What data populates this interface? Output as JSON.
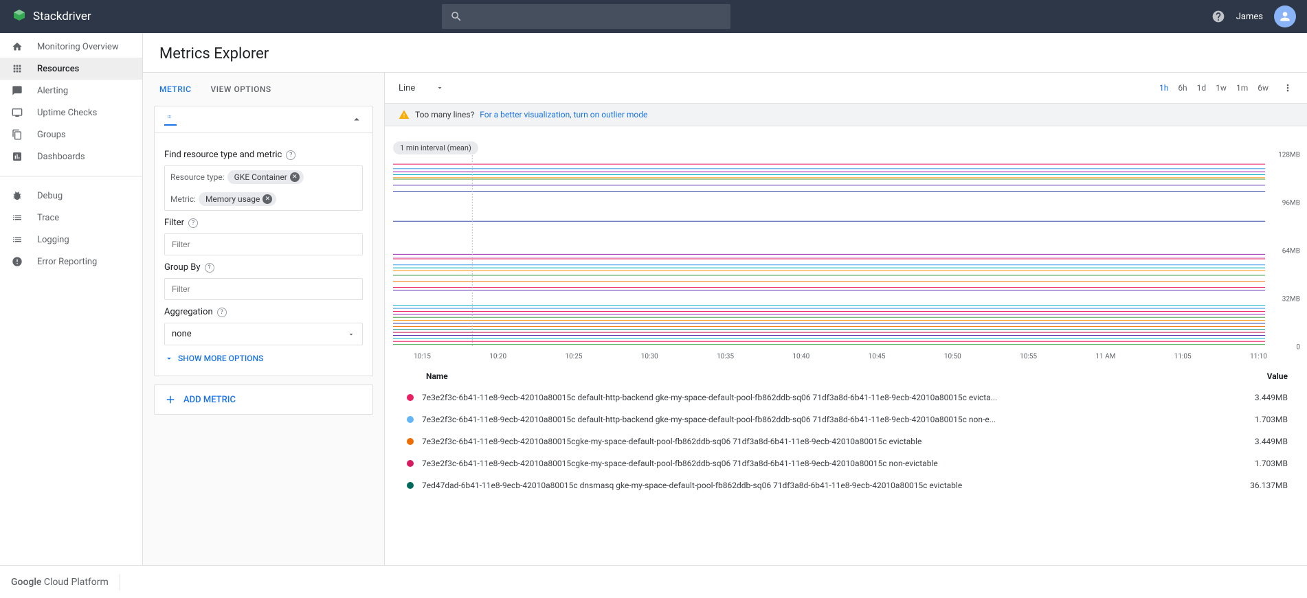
{
  "header": {
    "brand": "Stackdriver",
    "user": "James"
  },
  "sidebar": {
    "items": [
      {
        "label": "Monitoring Overview"
      },
      {
        "label": "Resources"
      },
      {
        "label": "Alerting"
      },
      {
        "label": "Uptime Checks"
      },
      {
        "label": "Groups"
      },
      {
        "label": "Dashboards"
      }
    ],
    "items2": [
      {
        "label": "Debug"
      },
      {
        "label": "Trace"
      },
      {
        "label": "Logging"
      },
      {
        "label": "Error Reporting"
      }
    ]
  },
  "page": {
    "title": "Metrics Explorer"
  },
  "config": {
    "tab_metric": "METRIC",
    "tab_view": "VIEW OPTIONS",
    "find_label": "Find resource type and metric",
    "resource_type_label": "Resource type:",
    "resource_type_value": "GKE Container",
    "metric_label": "Metric:",
    "metric_value": "Memory usage",
    "filter_label": "Filter",
    "filter_placeholder": "Filter",
    "groupby_label": "Group By",
    "groupby_placeholder": "Filter",
    "agg_label": "Aggregation",
    "agg_value": "none",
    "show_more": "SHOW MORE OPTIONS",
    "add_metric": "ADD METRIC"
  },
  "chart": {
    "type_label": "Line",
    "ranges": [
      "1h",
      "6h",
      "1d",
      "1w",
      "1m",
      "6w"
    ],
    "active_range": "1h",
    "warning_prefix": "Too many lines?",
    "warning_link": "For a better visualization, turn on outlier mode",
    "interval_chip": "1 min interval (mean)"
  },
  "chart_data": {
    "type": "line",
    "title": "",
    "xlabel": "",
    "ylabel": "",
    "ylim": [
      0,
      128
    ],
    "y_unit": "MB",
    "y_ticks": [
      "128MB",
      "96MB",
      "64MB",
      "32MB",
      "0"
    ],
    "x_ticks": [
      "10:15",
      "10:20",
      "10:25",
      "10:30",
      "10:35",
      "10:40",
      "10:45",
      "10:50",
      "10:55",
      "11 AM",
      "11:05",
      "11:10"
    ],
    "cursor_x": "10:20",
    "series": [
      {
        "color": "#e91e63",
        "y": 122
      },
      {
        "color": "#3f9ae8",
        "y": 119
      },
      {
        "color": "#9c27b0",
        "y": 117
      },
      {
        "color": "#00acc1",
        "y": 115
      },
      {
        "color": "#ff8f00",
        "y": 113
      },
      {
        "color": "#43a047",
        "y": 112
      },
      {
        "color": "#5e35b1",
        "y": 108
      },
      {
        "color": "#3949ab",
        "y": 104
      },
      {
        "color": "#3949ab",
        "y": 84
      },
      {
        "color": "#9c27b0",
        "y": 62
      },
      {
        "color": "#ce93d8",
        "y": 60
      },
      {
        "color": "#e91e63",
        "y": 59
      },
      {
        "color": "#3f9ae8",
        "y": 55
      },
      {
        "color": "#00acc1",
        "y": 53
      },
      {
        "color": "#ff8f00",
        "y": 51
      },
      {
        "color": "#43a047",
        "y": 48
      },
      {
        "color": "#ef6c00",
        "y": 44
      },
      {
        "color": "#e91e63",
        "y": 40
      },
      {
        "color": "#5e35b1",
        "y": 38
      },
      {
        "color": "#00acc1",
        "y": 28
      },
      {
        "color": "#3f9ae8",
        "y": 26
      },
      {
        "color": "#e91e63",
        "y": 24
      },
      {
        "color": "#9c27b0",
        "y": 22
      },
      {
        "color": "#43a047",
        "y": 20
      },
      {
        "color": "#ff8f00",
        "y": 18
      },
      {
        "color": "#3949ab",
        "y": 16
      },
      {
        "color": "#ef6c00",
        "y": 14
      },
      {
        "color": "#00897b",
        "y": 12
      },
      {
        "color": "#c2185b",
        "y": 10
      },
      {
        "color": "#5e35b1",
        "y": 8
      },
      {
        "color": "#00acc1",
        "y": 6
      },
      {
        "color": "#e91e63",
        "y": 4
      },
      {
        "color": "#43a047",
        "y": 2
      }
    ]
  },
  "legend": {
    "hdr_name": "Name",
    "hdr_value": "Value",
    "rows": [
      {
        "color": "#e91e63",
        "name": "7e3e2f3c-6b41-11e8-9ecb-42010a80015c default-http-backend gke-my-space-default-pool-fb862ddb-sq06 71df3a8d-6b41-11e8-9ecb-42010a80015c evicta...",
        "value": "3.449MB"
      },
      {
        "color": "#64b5f6",
        "name": "7e3e2f3c-6b41-11e8-9ecb-42010a80015c default-http-backend gke-my-space-default-pool-fb862ddb-sq06 71df3a8d-6b41-11e8-9ecb-42010a80015c non-e...",
        "value": "1.703MB"
      },
      {
        "color": "#ef6c00",
        "name": "7e3e2f3c-6b41-11e8-9ecb-42010a80015cgke-my-space-default-pool-fb862ddb-sq06 71df3a8d-6b41-11e8-9ecb-42010a80015c evictable",
        "value": "3.449MB"
      },
      {
        "color": "#d81b60",
        "name": "7e3e2f3c-6b41-11e8-9ecb-42010a80015cgke-my-space-default-pool-fb862ddb-sq06 71df3a8d-6b41-11e8-9ecb-42010a80015c non-evictable",
        "value": "1.703MB"
      },
      {
        "color": "#00695c",
        "name": "7ed47dad-6b41-11e8-9ecb-42010a80015c dnsmasq gke-my-space-default-pool-fb862ddb-sq06 71df3a8d-6b41-11e8-9ecb-42010a80015c evictable",
        "value": "36.137MB"
      }
    ]
  },
  "footer": {
    "brand1": "Google",
    "brand2": " Cloud Platform"
  }
}
